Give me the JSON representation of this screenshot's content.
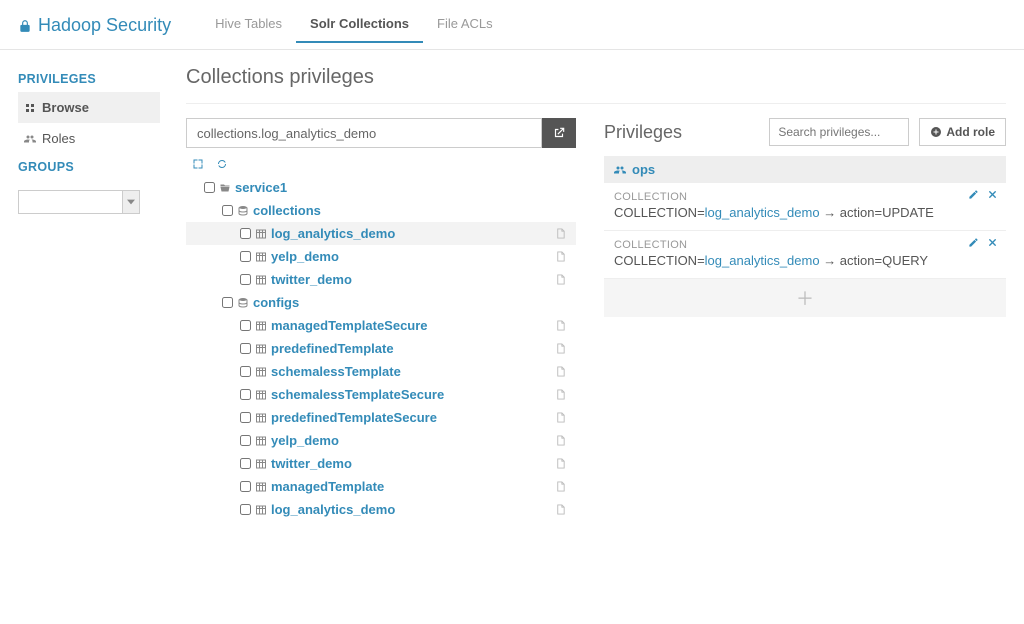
{
  "brand": "Hadoop Security",
  "tabs": [
    "Hive Tables",
    "Solr Collections",
    "File ACLs"
  ],
  "active_tab_index": 1,
  "sidebar": {
    "sections": [
      {
        "heading": "PRIVILEGES",
        "items": [
          {
            "icon": "sitemap",
            "label": "Browse",
            "active": true
          },
          {
            "icon": "users",
            "label": "Roles",
            "active": false
          }
        ]
      },
      {
        "heading": "GROUPS",
        "items": []
      }
    ],
    "group_select_value": ""
  },
  "page_title": "Collections privileges",
  "path_value": "collections.log_analytics_demo",
  "tree": [
    {
      "depth": 1,
      "icon": "folder-open",
      "label": "service1",
      "trail": null,
      "selected": false
    },
    {
      "depth": 2,
      "icon": "database",
      "label": "collections",
      "trail": null,
      "selected": false
    },
    {
      "depth": 3,
      "icon": "table",
      "label": "log_analytics_demo",
      "trail": "file",
      "selected": true
    },
    {
      "depth": 3,
      "icon": "table",
      "label": "yelp_demo",
      "trail": "file",
      "selected": false
    },
    {
      "depth": 3,
      "icon": "table",
      "label": "twitter_demo",
      "trail": "file",
      "selected": false
    },
    {
      "depth": 2,
      "icon": "database",
      "label": "configs",
      "trail": null,
      "selected": false
    },
    {
      "depth": 3,
      "icon": "table",
      "label": "managedTemplateSecure",
      "trail": "file",
      "selected": false
    },
    {
      "depth": 3,
      "icon": "table",
      "label": "predefinedTemplate",
      "trail": "file",
      "selected": false
    },
    {
      "depth": 3,
      "icon": "table",
      "label": "schemalessTemplate",
      "trail": "file",
      "selected": false
    },
    {
      "depth": 3,
      "icon": "table",
      "label": "schemalessTemplateSecure",
      "trail": "file",
      "selected": false
    },
    {
      "depth": 3,
      "icon": "table",
      "label": "predefinedTemplateSecure",
      "trail": "file",
      "selected": false
    },
    {
      "depth": 3,
      "icon": "table",
      "label": "yelp_demo",
      "trail": "file",
      "selected": false
    },
    {
      "depth": 3,
      "icon": "table",
      "label": "twitter_demo",
      "trail": "file",
      "selected": false
    },
    {
      "depth": 3,
      "icon": "table",
      "label": "managedTemplate",
      "trail": "file",
      "selected": false
    },
    {
      "depth": 3,
      "icon": "table",
      "label": "log_analytics_demo",
      "trail": "file",
      "selected": false
    }
  ],
  "privileges_panel": {
    "title": "Privileges",
    "search_placeholder": "Search privileges...",
    "add_role_label": "Add role",
    "role_name": "ops",
    "cards": [
      {
        "type": "COLLECTION",
        "prefix": "COLLECTION=",
        "target": "log_analytics_demo",
        "action_label": "action=",
        "action": "UPDATE"
      },
      {
        "type": "COLLECTION",
        "prefix": "COLLECTION=",
        "target": "log_analytics_demo",
        "action_label": "action=",
        "action": "QUERY"
      }
    ]
  }
}
